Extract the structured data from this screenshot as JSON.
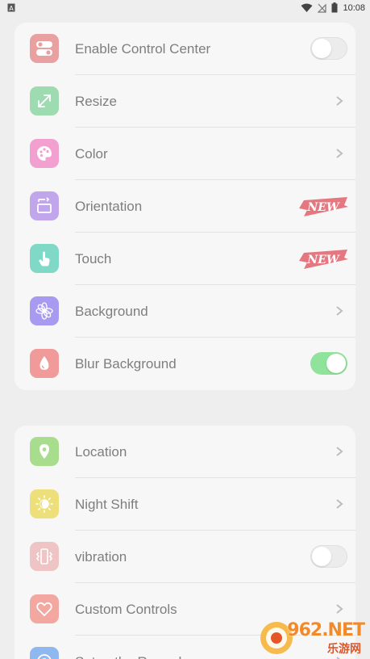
{
  "status_bar": {
    "time": "10:08",
    "icons": [
      "app-notification-icon",
      "wifi-icon",
      "no-signal-icon",
      "battery-icon"
    ]
  },
  "colors": {
    "toggle_on": "#8fe39a",
    "new_badge": "#e0606a"
  },
  "group1": [
    {
      "label": "Enable Control Center",
      "icon": "toggle-switch-icon",
      "icon_color": "#e8a0a0",
      "accessory": "toggle",
      "toggle_on": false
    },
    {
      "label": "Resize",
      "icon": "resize-arrows-icon",
      "icon_color": "#9fdbb0",
      "accessory": "chevron"
    },
    {
      "label": "Color",
      "icon": "palette-icon",
      "icon_color": "#f2a0d0",
      "accessory": "chevron"
    },
    {
      "label": "Orientation",
      "icon": "orientation-icon",
      "icon_color": "#c2a6ec",
      "accessory": "new-badge",
      "badge_text": "NEW"
    },
    {
      "label": "Touch",
      "icon": "touch-hand-icon",
      "icon_color": "#7fd9c6",
      "accessory": "new-badge",
      "badge_text": "NEW"
    },
    {
      "label": "Background",
      "icon": "flower-icon",
      "icon_color": "#a79af0",
      "accessory": "chevron"
    },
    {
      "label": "Blur Background",
      "icon": "water-drop-icon",
      "icon_color": "#f09a9a",
      "accessory": "toggle",
      "toggle_on": true
    }
  ],
  "group2": [
    {
      "label": "Location",
      "icon": "location-pin-icon",
      "icon_color": "#a9dd8e",
      "accessory": "chevron"
    },
    {
      "label": "Night Shift",
      "icon": "sun-moon-icon",
      "icon_color": "#ede07a",
      "accessory": "chevron"
    },
    {
      "label": "vibration",
      "icon": "vibration-phone-icon",
      "icon_color": "#efc4c4",
      "accessory": "toggle",
      "toggle_on": false
    },
    {
      "label": "Custom Controls",
      "icon": "heart-icon",
      "icon_color": "#f2a8a0",
      "accessory": "chevron"
    },
    {
      "label": "Setup the Record",
      "icon": "record-icon",
      "icon_color": "#8fb8f0",
      "accessory": "chevron"
    }
  ],
  "watermark": {
    "line1": "962.NET",
    "line2": "乐游网"
  }
}
